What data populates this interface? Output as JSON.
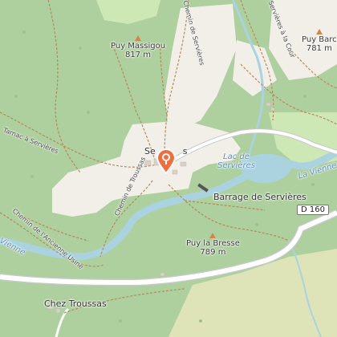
{
  "map": {
    "peaks": [
      {
        "name": "Puy Massigou",
        "elevation": "817 m"
      },
      {
        "name": "Puy Barc",
        "elevation": "781 m"
      },
      {
        "name": "Puy la Bresse",
        "elevation": "789 m"
      }
    ],
    "places": {
      "village": "Servières",
      "village_visible": "Se",
      "village_suffix": "s",
      "dam": "Barrage de Servières",
      "hamlet": "Chez Troussas"
    },
    "water": {
      "lake_line1": "Lac de",
      "lake_line2": "Servières",
      "river": "La Vienne",
      "river_short": "Vienne"
    },
    "paths": {
      "tarnac": "Tarnac à Servières",
      "chemin_usine": "Chemin de l'Ancienne Usine",
      "chemin_troussas": "Chemin de Troussas",
      "chemin_top": "Chemin de Servières",
      "la_cour": "Servières à la Cour"
    },
    "road": {
      "ref": "D 160"
    },
    "marker": {
      "icon": "location-pin-icon",
      "color": "#ee6e3e"
    },
    "colors": {
      "forest": "#aecf9e",
      "meadow": "#cde8b5",
      "farmland": "#f2efe9",
      "scrub": "#dfe3b8",
      "water": "#aad3df",
      "road": "#ffffff",
      "peak": "#d2864e"
    }
  }
}
